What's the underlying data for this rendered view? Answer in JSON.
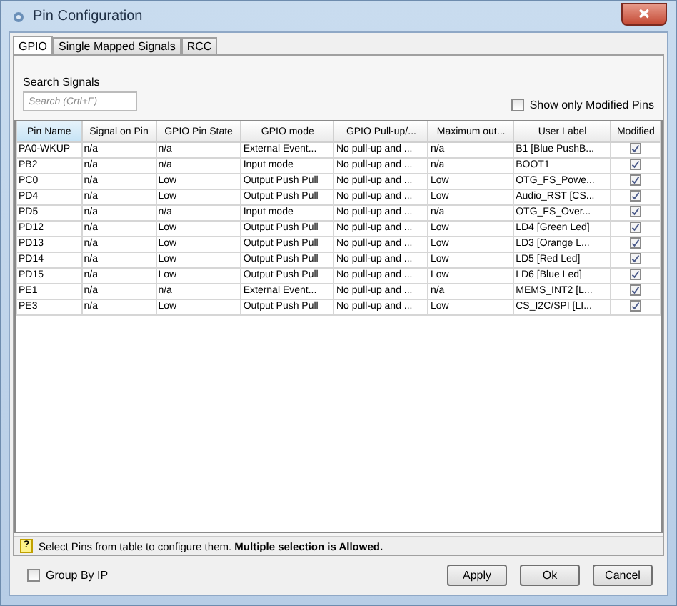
{
  "window": {
    "title": "Pin Configuration"
  },
  "tabs": [
    {
      "label": "GPIO",
      "selected": true
    },
    {
      "label": "Single Mapped Signals",
      "selected": false
    },
    {
      "label": "RCC",
      "selected": false
    }
  ],
  "search": {
    "label": "Search Signals",
    "placeholder": "Search (Crtl+F)"
  },
  "show_only_modified": {
    "label": "Show only Modified Pins",
    "checked": false
  },
  "table": {
    "columns": [
      "Pin Name",
      "Signal on Pin",
      "GPIO Pin State",
      "GPIO mode",
      "GPIO Pull-up/...",
      "Maximum out...",
      "User Label",
      "Modified"
    ],
    "rows": [
      {
        "cells": [
          "PA0-WKUP",
          "n/a",
          "n/a",
          "External Event...",
          "No pull-up and ...",
          "n/a",
          "B1 [Blue PushB..."
        ],
        "modified": true
      },
      {
        "cells": [
          "PB2",
          "n/a",
          "n/a",
          "Input mode",
          "No pull-up and ...",
          "n/a",
          "BOOT1"
        ],
        "modified": true
      },
      {
        "cells": [
          "PC0",
          "n/a",
          "Low",
          "Output Push Pull",
          "No pull-up and ...",
          "Low",
          "OTG_FS_Powe..."
        ],
        "modified": true
      },
      {
        "cells": [
          "PD4",
          "n/a",
          "Low",
          "Output Push Pull",
          "No pull-up and ...",
          "Low",
          "Audio_RST [CS..."
        ],
        "modified": true
      },
      {
        "cells": [
          "PD5",
          "n/a",
          "n/a",
          "Input mode",
          "No pull-up and ...",
          "n/a",
          "OTG_FS_Over..."
        ],
        "modified": true
      },
      {
        "cells": [
          "PD12",
          "n/a",
          "Low",
          "Output Push Pull",
          "No pull-up and ...",
          "Low",
          "LD4 [Green Led]"
        ],
        "modified": true
      },
      {
        "cells": [
          "PD13",
          "n/a",
          "Low",
          "Output Push Pull",
          "No pull-up and ...",
          "Low",
          "LD3 [Orange L..."
        ],
        "modified": true
      },
      {
        "cells": [
          "PD14",
          "n/a",
          "Low",
          "Output Push Pull",
          "No pull-up and ...",
          "Low",
          "LD5 [Red Led]"
        ],
        "modified": true
      },
      {
        "cells": [
          "PD15",
          "n/a",
          "Low",
          "Output Push Pull",
          "No pull-up and ...",
          "Low",
          "LD6 [Blue Led]"
        ],
        "modified": true
      },
      {
        "cells": [
          "PE1",
          "n/a",
          "n/a",
          "External Event...",
          "No pull-up and ...",
          "n/a",
          "MEMS_INT2 [L..."
        ],
        "modified": true
      },
      {
        "cells": [
          "PE3",
          "n/a",
          "Low",
          "Output Push Pull",
          "No pull-up and ...",
          "Low",
          "CS_I2C/SPI [LI..."
        ],
        "modified": true
      }
    ]
  },
  "status_bar": {
    "icon": "?",
    "text": "Select Pins from table to configure them. **Multiple selection is Allowed.**"
  },
  "group_by_ip": {
    "label": "Group By IP",
    "checked": false
  },
  "buttons": [
    "Apply",
    "Ok",
    "Cancel"
  ]
}
